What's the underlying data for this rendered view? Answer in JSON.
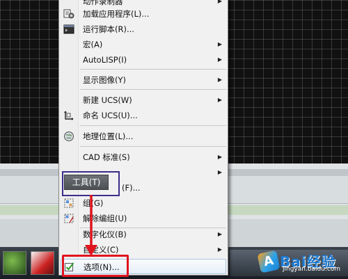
{
  "menu": {
    "items": [
      {
        "label": "动作录制器",
        "icon": "",
        "arrow": true
      },
      {
        "label": "加载应用程序(L)...",
        "icon": "load-app-icon",
        "arrow": false
      },
      {
        "label": "运行脚本(R)...",
        "icon": "run-script-icon",
        "arrow": false
      },
      {
        "label": "宏(A)",
        "icon": "",
        "arrow": true
      },
      {
        "label": "AutoLISP(I)",
        "icon": "",
        "arrow": true
      },
      {
        "label": "显示图像(Y)",
        "icon": "",
        "arrow": true
      },
      {
        "label": "新建 UCS(W)",
        "icon": "",
        "arrow": true
      },
      {
        "label": "命名 UCS(U)...",
        "icon": "named-ucs-icon",
        "arrow": false
      },
      {
        "label": "地理位置(L)...",
        "icon": "geo-location-icon",
        "arrow": false
      },
      {
        "label": "CAD 标准(S)",
        "icon": "",
        "arrow": true
      },
      {
        "label": "(F)...",
        "icon": "",
        "arrow": true
      },
      {
        "label": "组(G)",
        "icon": "group-icon",
        "arrow": false
      },
      {
        "label": "解除编组(U)",
        "icon": "ungroup-icon",
        "arrow": false
      },
      {
        "label": "数字化仪(B)",
        "icon": "",
        "arrow": true
      },
      {
        "label": "自定义(C)",
        "icon": "",
        "arrow": true
      },
      {
        "label": "选项(N)...",
        "icon": "options-check-icon",
        "arrow": false
      }
    ]
  },
  "tools_button": {
    "label": "工具(T)"
  },
  "watermark": {
    "text": "Bai经验",
    "sub": "jingyan.baidu.com"
  },
  "colors": {
    "highlight_red": "#e0141e",
    "tools_box": "#3b2d8a"
  }
}
